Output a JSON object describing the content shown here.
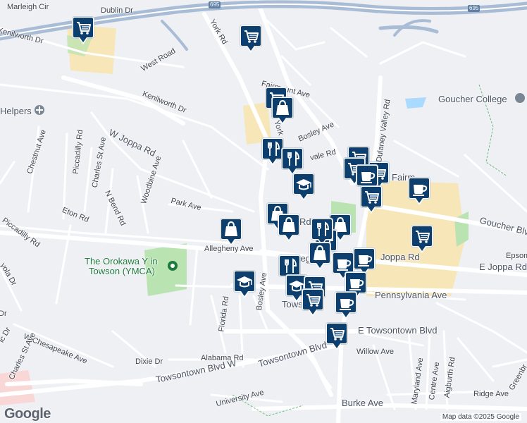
{
  "map": {
    "brand": "Google",
    "attribution": "Map data ©2025 Google"
  },
  "labels": [
    {
      "id": "marleigh",
      "text": "Marleigh Cir"
    },
    {
      "id": "dublin",
      "text": "Dublin Dr"
    },
    {
      "id": "i695a",
      "text": "695"
    },
    {
      "id": "i695b",
      "text": "695"
    },
    {
      "id": "kenilworth-dr-top",
      "text": "Kenilworth Dr"
    },
    {
      "id": "york-rd-top",
      "text": "York Rd"
    },
    {
      "id": "west-road",
      "text": "West Road"
    },
    {
      "id": "fairmount-ave",
      "text": "Fairmount Ave"
    },
    {
      "id": "goucher-college",
      "text": "Goucher College"
    },
    {
      "id": "helpers",
      "text": "Helpers"
    },
    {
      "id": "kenilworth-dr",
      "text": "Kenilworth Dr"
    },
    {
      "id": "dulaney-valley-rd",
      "text": "Dulaney Valley Rd"
    },
    {
      "id": "bosley-ave-top",
      "text": "Bosley Ave"
    },
    {
      "id": "york-mid",
      "text": "York"
    },
    {
      "id": "chestnut-ave",
      "text": "Chestnut Ave"
    },
    {
      "id": "piccadilly-rd-a",
      "text": "Piccadilly Rd"
    },
    {
      "id": "charles-st-ave",
      "text": "Charles St Ave"
    },
    {
      "id": "w-joppa-rd",
      "text": "W Joppa Rd"
    },
    {
      "id": "n-bend-rd",
      "text": "N Bend Rd"
    },
    {
      "id": "woodbine-ave",
      "text": "Woodbine Ave"
    },
    {
      "id": "eton-rd",
      "text": "Eton Rd"
    },
    {
      "id": "park-ave",
      "text": "Park Ave"
    },
    {
      "id": "piccadilly-rd-b",
      "text": "Piccadilly Rd"
    },
    {
      "id": "allegheny-ave",
      "text": "Allegheny Ave"
    },
    {
      "id": "orokawa",
      "text": "The Orokawa Y in"
    },
    {
      "id": "orokawa2",
      "text": "Towson (YMCA)"
    },
    {
      "id": "goucher-blvd",
      "text": "Goucher Blvd"
    },
    {
      "id": "joppa-rd",
      "text": "Joppa Rd"
    },
    {
      "id": "e-joppa-rd",
      "text": "E Joppa Rd"
    },
    {
      "id": "epsom",
      "text": "Epsom"
    },
    {
      "id": "pennsylvania-ave",
      "text": "Pennsylvania Ave"
    },
    {
      "id": "bosley-ave",
      "text": "Bosley Ave"
    },
    {
      "id": "florida-rd",
      "text": "Florida Rd"
    },
    {
      "id": "e-towsontown-blvd",
      "text": "E Towsontown Blvd"
    },
    {
      "id": "w-chesapeake-ave",
      "text": "W Chesapeake Ave"
    },
    {
      "id": "charles-st-ave-b",
      "text": "Charles St Ave"
    },
    {
      "id": "dixie-dr",
      "text": "Dixie Dr"
    },
    {
      "id": "alabama-rd",
      "text": "Alabama Rd"
    },
    {
      "id": "towsontown-blvd",
      "text": "Towsontown Blvd"
    },
    {
      "id": "towsontown-blvd-w",
      "text": "Towsontown Blvd W"
    },
    {
      "id": "willow-ave",
      "text": "Willow Ave"
    },
    {
      "id": "maryland-ave",
      "text": "Maryland Ave"
    },
    {
      "id": "centre-ave",
      "text": "Centre Ave"
    },
    {
      "id": "aigburth-rd",
      "text": "Aigburth Rd"
    },
    {
      "id": "ridge-ave",
      "text": "Ridge Ave"
    },
    {
      "id": "greenbr",
      "text": "Greenbr"
    },
    {
      "id": "university-ave",
      "text": "University Ave"
    },
    {
      "id": "burke-ave",
      "text": "Burke Ave"
    },
    {
      "id": "towson",
      "text": "Towson"
    },
    {
      "id": "rd-mid",
      "text": "Rd"
    },
    {
      "id": "alleg-mid",
      "text": "Alleg"
    },
    {
      "id": "fairm",
      "text": "Fairm"
    },
    {
      "id": "vale-rd",
      "text": "vale Rd"
    },
    {
      "id": "dr-left",
      "text": "Dr"
    },
    {
      "id": "yola",
      "text": "yola Dr"
    },
    {
      "id": "ic-dr",
      "text": "ic Dr"
    }
  ],
  "markers": [
    {
      "id": "m1",
      "type": "grocery"
    },
    {
      "id": "m2",
      "type": "grocery"
    },
    {
      "id": "m3",
      "type": "grocery"
    },
    {
      "id": "m4",
      "type": "shopping"
    },
    {
      "id": "m5",
      "type": "restaurant"
    },
    {
      "id": "m6",
      "type": "restaurant"
    },
    {
      "id": "m7",
      "type": "grocery"
    },
    {
      "id": "m8",
      "type": "grocery"
    },
    {
      "id": "m9",
      "type": "cafe"
    },
    {
      "id": "m10",
      "type": "school"
    },
    {
      "id": "m11",
      "type": "grocery"
    },
    {
      "id": "m12",
      "type": "cafe"
    },
    {
      "id": "m13",
      "type": "shopping"
    },
    {
      "id": "m14",
      "type": "shopping"
    },
    {
      "id": "m15",
      "type": "shopping"
    },
    {
      "id": "m16",
      "type": "grocery"
    },
    {
      "id": "m17",
      "type": "restaurant"
    },
    {
      "id": "m18",
      "type": "shopping"
    },
    {
      "id": "m19",
      "type": "cafe"
    },
    {
      "id": "m20",
      "type": "restaurant"
    },
    {
      "id": "m21",
      "type": "school"
    },
    {
      "id": "m22",
      "type": "school"
    },
    {
      "id": "m23",
      "type": "grocery"
    },
    {
      "id": "m24",
      "type": "cafe"
    },
    {
      "id": "m25",
      "type": "cafe"
    },
    {
      "id": "m26",
      "type": "grocery"
    },
    {
      "id": "m27",
      "type": "grocery"
    }
  ],
  "colors": {
    "marker": "#0d3f6e",
    "road": "#ffffff",
    "highway": "#a9bcd6",
    "park": "#b9e3b0",
    "commercial": "#f6e6b8",
    "water": "#aadaff"
  }
}
